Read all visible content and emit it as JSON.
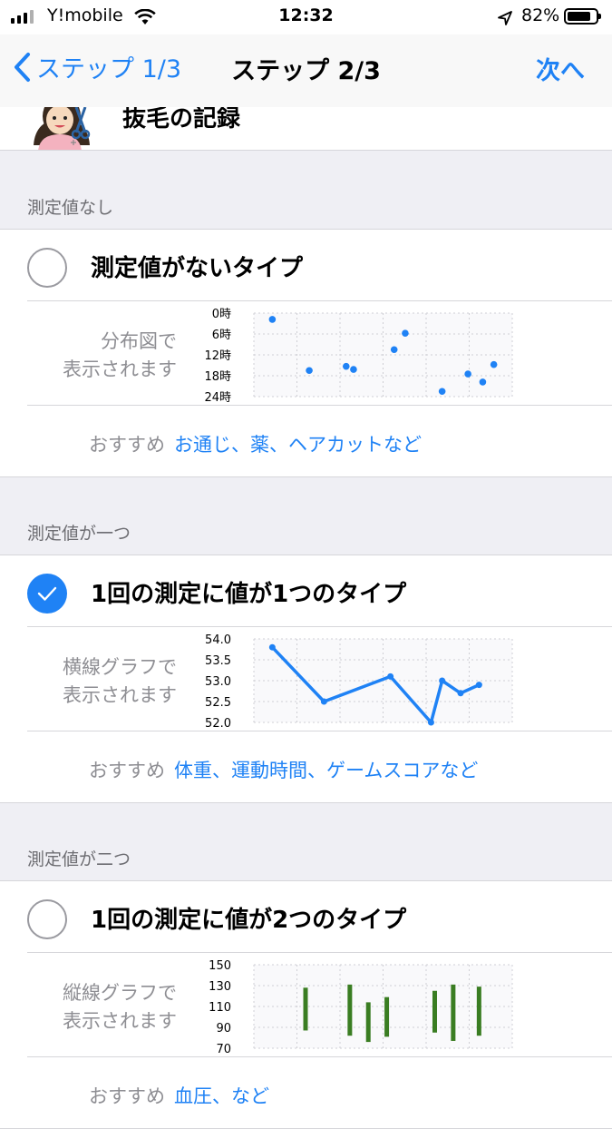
{
  "status_bar": {
    "carrier": "Y!mobile",
    "time": "12:32",
    "battery": "82%",
    "battery_level": 0.82
  },
  "nav": {
    "back_label": "ステップ 1/3",
    "title": "ステップ 2/3",
    "next_label": "次へ"
  },
  "header": {
    "title": "抜毛の記録"
  },
  "sections": [
    {
      "label": "測定値なし",
      "option_title": "測定値がないタイプ",
      "selected": false,
      "graph_label": "分布図で\n表示されます",
      "recommend_key": "おすすめ",
      "recommend_value": "お通じ、薬、ヘアカットなど"
    },
    {
      "label": "測定値が一つ",
      "option_title": "1回の測定に値が1つのタイプ",
      "selected": true,
      "graph_label": "横線グラフで\n表示されます",
      "recommend_key": "おすすめ",
      "recommend_value": "体重、運動時間、ゲームスコアなど"
    },
    {
      "label": "測定値が二つ",
      "option_title": "1回の測定に値が2つのタイプ",
      "selected": false,
      "graph_label": "縦線グラフで\n表示されます",
      "recommend_key": "おすすめ",
      "recommend_value": "血圧、など"
    }
  ],
  "colors": {
    "accent": "#1f82f5",
    "bar_green": "#3a7d22",
    "checkbox": "#1f82f5"
  },
  "chart_data": [
    {
      "type": "scatter",
      "ytick_labels": [
        "0時",
        "6時",
        "12時",
        "18時",
        "24時"
      ],
      "ylim": [
        0,
        24
      ],
      "y_inverted": true,
      "x": [
        1,
        2,
        3,
        3.2,
        4.3,
        4.6,
        5.6,
        6.3,
        6.7,
        7
      ],
      "y": [
        1.8,
        16.5,
        15.3,
        16.2,
        10.5,
        5.8,
        22.5,
        17.5,
        19.8,
        14.8
      ]
    },
    {
      "type": "line",
      "ytick_labels": [
        "54.0",
        "53.5",
        "53.0",
        "52.5",
        "52.0"
      ],
      "ylim": [
        52.0,
        54.0
      ],
      "x": [
        1,
        2.4,
        4.2,
        5.3,
        5.6,
        6.1,
        6.6
      ],
      "y": [
        53.8,
        52.5,
        53.1,
        52.0,
        53.0,
        52.7,
        52.9
      ]
    },
    {
      "type": "bar",
      "ytick_labels": [
        "150",
        "130",
        "110",
        "90",
        "70"
      ],
      "ylim": [
        70,
        150
      ],
      "ranges": [
        [
          1.9,
          87,
          128
        ],
        [
          3.1,
          82,
          131
        ],
        [
          3.6,
          76,
          114
        ],
        [
          4.1,
          81,
          119
        ],
        [
          5.4,
          85,
          125
        ],
        [
          5.9,
          77,
          131
        ],
        [
          6.6,
          82,
          129
        ]
      ]
    }
  ]
}
